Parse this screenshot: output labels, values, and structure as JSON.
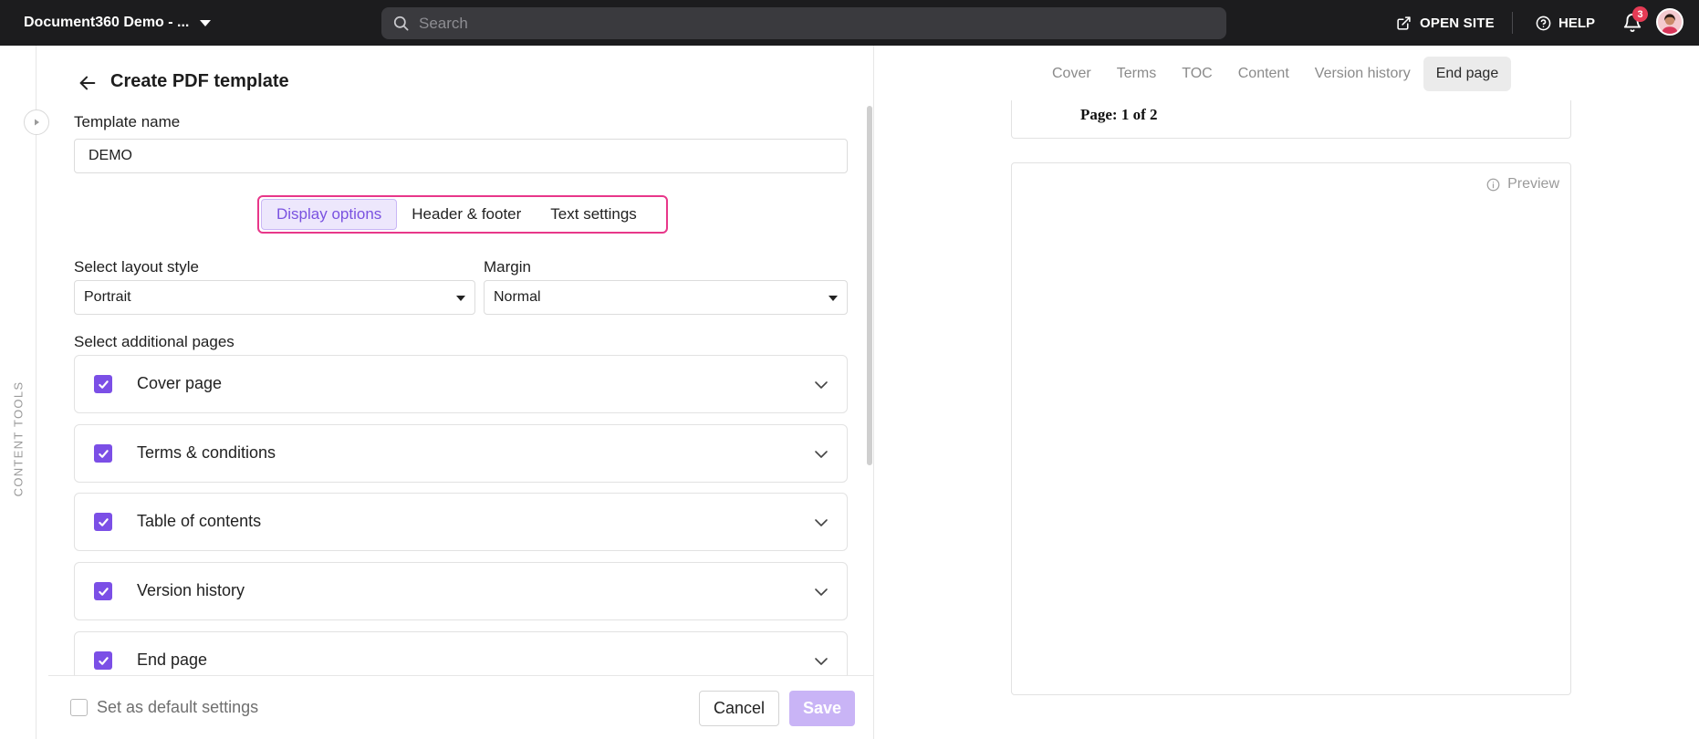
{
  "topbar": {
    "project_name": "Document360 Demo - ...",
    "search_placeholder": "Search",
    "open_site_label": "OPEN SITE",
    "help_label": "HELP",
    "notification_count": "3"
  },
  "rail": {
    "label": "CONTENT TOOLS"
  },
  "panel": {
    "title": "Create PDF template",
    "template_name_label": "Template name",
    "template_name_value": "DEMO",
    "tabs": [
      {
        "label": "Display options",
        "active": true
      },
      {
        "label": "Header & footer",
        "active": false
      },
      {
        "label": "Text settings",
        "active": false
      }
    ],
    "layout_label": "Select layout style",
    "layout_value": "Portrait",
    "margin_label": "Margin",
    "margin_value": "Normal",
    "additional_pages_label": "Select additional pages",
    "pages": [
      {
        "label": "Cover page",
        "checked": true
      },
      {
        "label": "Terms & conditions",
        "checked": true
      },
      {
        "label": "Table of contents",
        "checked": true
      },
      {
        "label": "Version history",
        "checked": true
      },
      {
        "label": "End page",
        "checked": true
      }
    ],
    "default_settings_label": "Set as default settings",
    "default_settings_checked": false,
    "cancel_label": "Cancel",
    "save_label": "Save"
  },
  "preview": {
    "tabs": [
      {
        "label": "Cover",
        "active": false
      },
      {
        "label": "Terms",
        "active": false
      },
      {
        "label": "TOC",
        "active": false
      },
      {
        "label": "Content",
        "active": false
      },
      {
        "label": "Version history",
        "active": false
      },
      {
        "label": "End page",
        "active": true
      }
    ],
    "page_number_text": "Page: 1 of 2",
    "preview_label": "Preview"
  },
  "colors": {
    "topbar_bg": "#1c1c1e",
    "accent_purple": "#7b4fe6",
    "tab_highlight_border": "#e8378a",
    "save_disabled": "#c9b4f6",
    "badge_red": "#e53b55"
  }
}
